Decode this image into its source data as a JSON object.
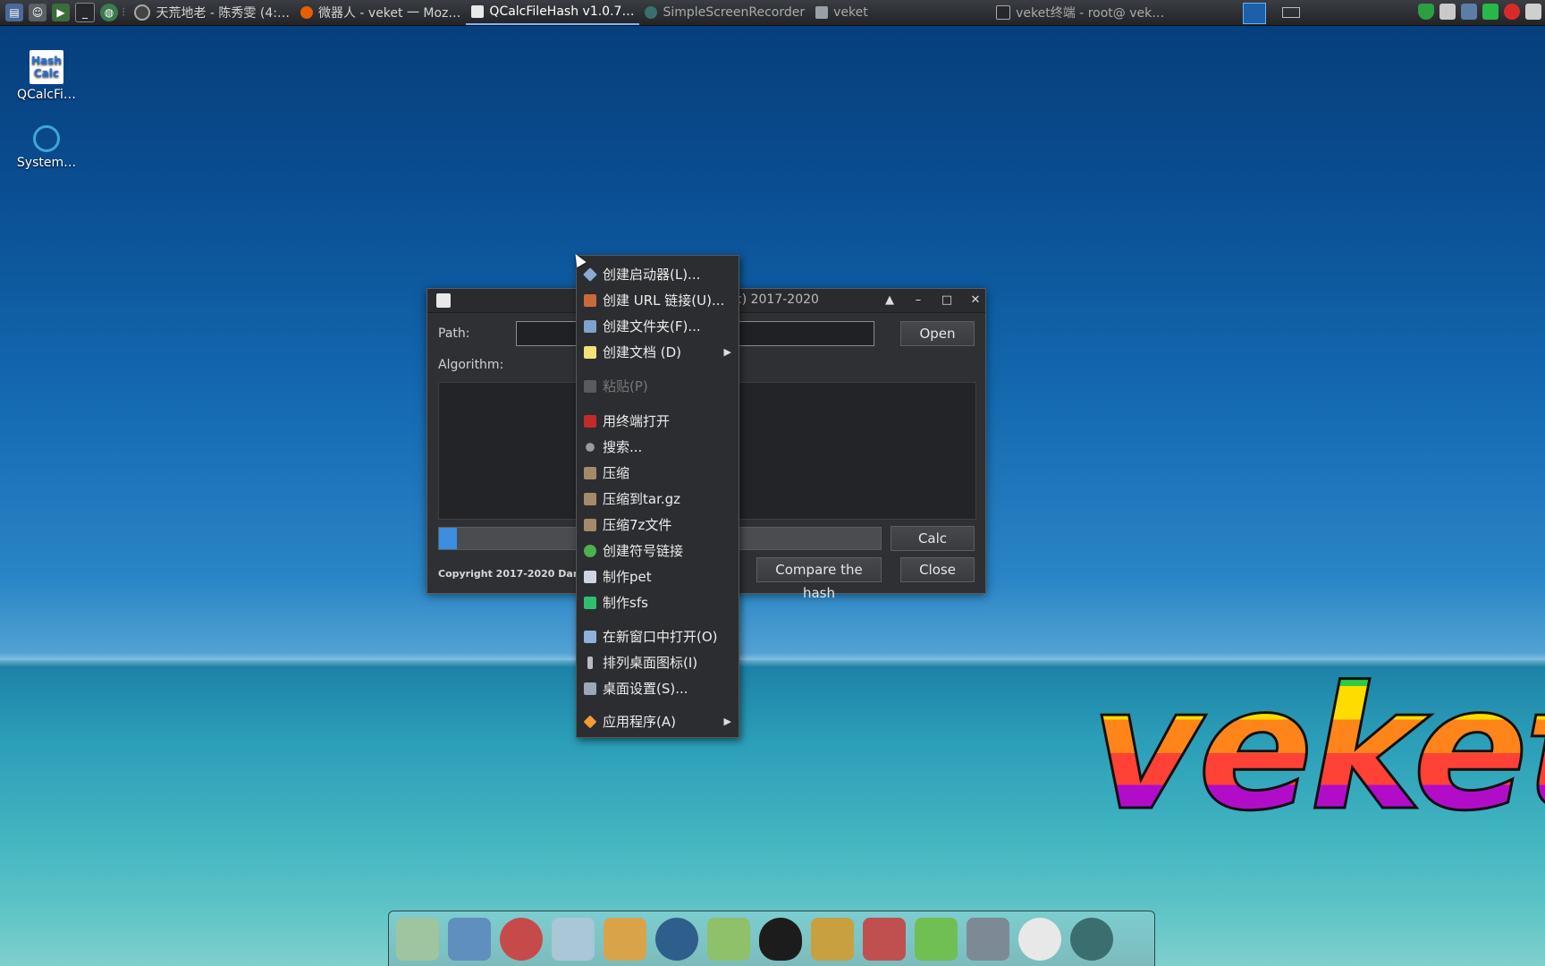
{
  "taskbar": {
    "tasks": [
      {
        "label": "天荒地老 - 陈秀雯 (4:…",
        "icon": "music-player-icon"
      },
      {
        "label": "微器人 - veket 一 Moz…",
        "icon": "firefox-icon"
      },
      {
        "label": "QCalcFileHash v1.0.7…",
        "icon": "hashcalc-icon",
        "active": true
      },
      {
        "label": "SimpleScreenRecorder",
        "icon": "recorder-icon"
      },
      {
        "label": "veket",
        "icon": "folder-icon"
      },
      {
        "label": "veket终端 - root@ vek…",
        "icon": "terminal-icon"
      }
    ]
  },
  "desktop": {
    "icons": [
      {
        "label": "QCalcFi…",
        "img_text_1": "Hash",
        "img_text_2": "Calc"
      },
      {
        "label": "System…"
      }
    ]
  },
  "window": {
    "title": "QCalcFileHash v1.0.7 (c) 2017-2020",
    "path_label": "Path:",
    "path_value": "",
    "open_label": "Open",
    "algorithm_label": "Algorithm:",
    "calc_label": "Calc",
    "compare_label": "Compare the hash",
    "close_label": "Close",
    "copyright": "Copyright 2017-2020 DanSoft.",
    "progress": 0.01
  },
  "context_menu": {
    "items": [
      {
        "label": "创建启动器(L)...",
        "icon": "launcher-icon"
      },
      {
        "label": "创建 URL 链接(U)...",
        "icon": "link-icon"
      },
      {
        "label": "创建文件夹(F)...",
        "icon": "folder-icon"
      },
      {
        "label": "创建文档 (D)",
        "icon": "document-icon",
        "submenu": true
      },
      {
        "label": "粘贴(P)",
        "icon": "paste-icon",
        "disabled": true
      },
      {
        "label": "用终端打开",
        "icon": "terminal-icon"
      },
      {
        "label": "搜索...",
        "icon": "search-icon"
      },
      {
        "label": "压缩",
        "icon": "archive-icon"
      },
      {
        "label": "压缩到tar.gz",
        "icon": "archive-icon"
      },
      {
        "label": "压缩7z文件",
        "icon": "archive-icon"
      },
      {
        "label": "创建符号链接",
        "icon": "symlink-icon"
      },
      {
        "label": "制作pet",
        "icon": "computer-icon"
      },
      {
        "label": "制作sfs",
        "icon": "package-icon"
      },
      {
        "label": "在新窗口中打开(O)",
        "icon": "window-icon"
      },
      {
        "label": "排列桌面图标(I)",
        "icon": "arrange-icon"
      },
      {
        "label": "桌面设置(S)...",
        "icon": "desktop-settings-icon"
      },
      {
        "label": "应用程序(A)",
        "icon": "applications-icon",
        "submenu": true
      }
    ]
  },
  "wallpaper": {
    "logo_text": "veket"
  },
  "dock": {
    "items": [
      "shell-icon",
      "monitor-icon",
      "hedgehog-icon",
      "editor-icon",
      "paint-icon",
      "media-icon",
      "users-icon",
      "penguin-icon",
      "notes-icon",
      "chart-icon",
      "network-icon",
      "drive-icon",
      "settings-icon",
      "globe-icon"
    ]
  },
  "colors": {
    "accent": "#3b8ee0",
    "menu_bg": "#2c2d30",
    "window_bg": "#2f3033"
  }
}
